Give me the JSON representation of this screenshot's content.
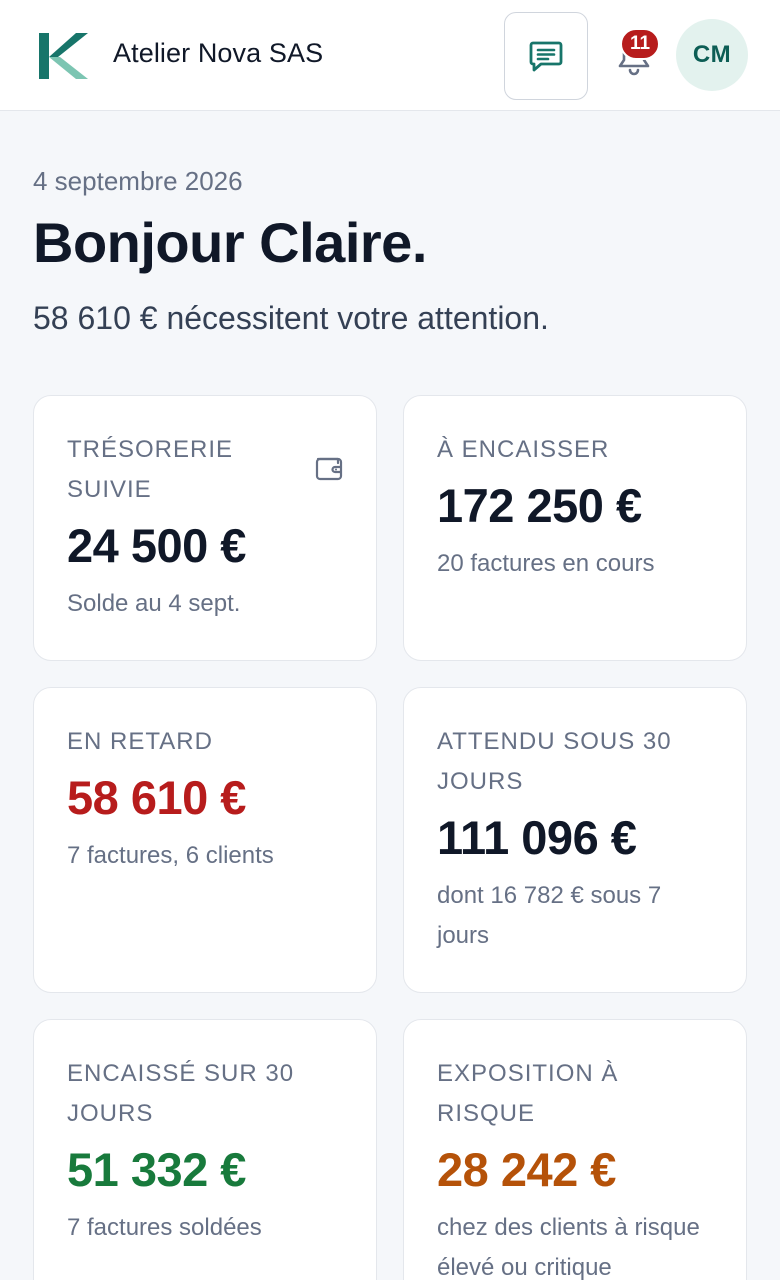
{
  "header": {
    "company_name": "Atelier Nova SAS",
    "notification_count": "11",
    "avatar_initials": "CM",
    "brand_color": "#17756a"
  },
  "intro": {
    "date": "4 septembre 2026",
    "greeting": "Bonjour Claire.",
    "attention": "58 610 € nécessitent votre attention."
  },
  "cards": [
    {
      "label": "TRÉSORERIE SUIVIE",
      "value": "24 500 €",
      "sub": "Solde au 4 sept.",
      "icon": "wallet-icon",
      "color": "#101828"
    },
    {
      "label": "À ENCAISSER",
      "value": "172 250 €",
      "sub": "20 factures en cours",
      "color": "#101828"
    },
    {
      "label": "EN RETARD",
      "value": "58 610 €",
      "sub": "7 factures, 6 clients",
      "color": "#b71c1c"
    },
    {
      "label": "ATTENDU SOUS 30 JOURS",
      "value": "111 096 €",
      "sub": "dont 16 782 € sous 7 jours",
      "color": "#101828"
    },
    {
      "label": "ENCAISSÉ SUR 30 JOURS",
      "value": "51 332 €",
      "sub": "7 factures soldées",
      "color": "#187a3c"
    },
    {
      "label": "EXPOSITION À RISQUE",
      "value": "28 242 €",
      "sub": "chez des clients à risque élevé ou critique",
      "color": "#b55209"
    }
  ]
}
